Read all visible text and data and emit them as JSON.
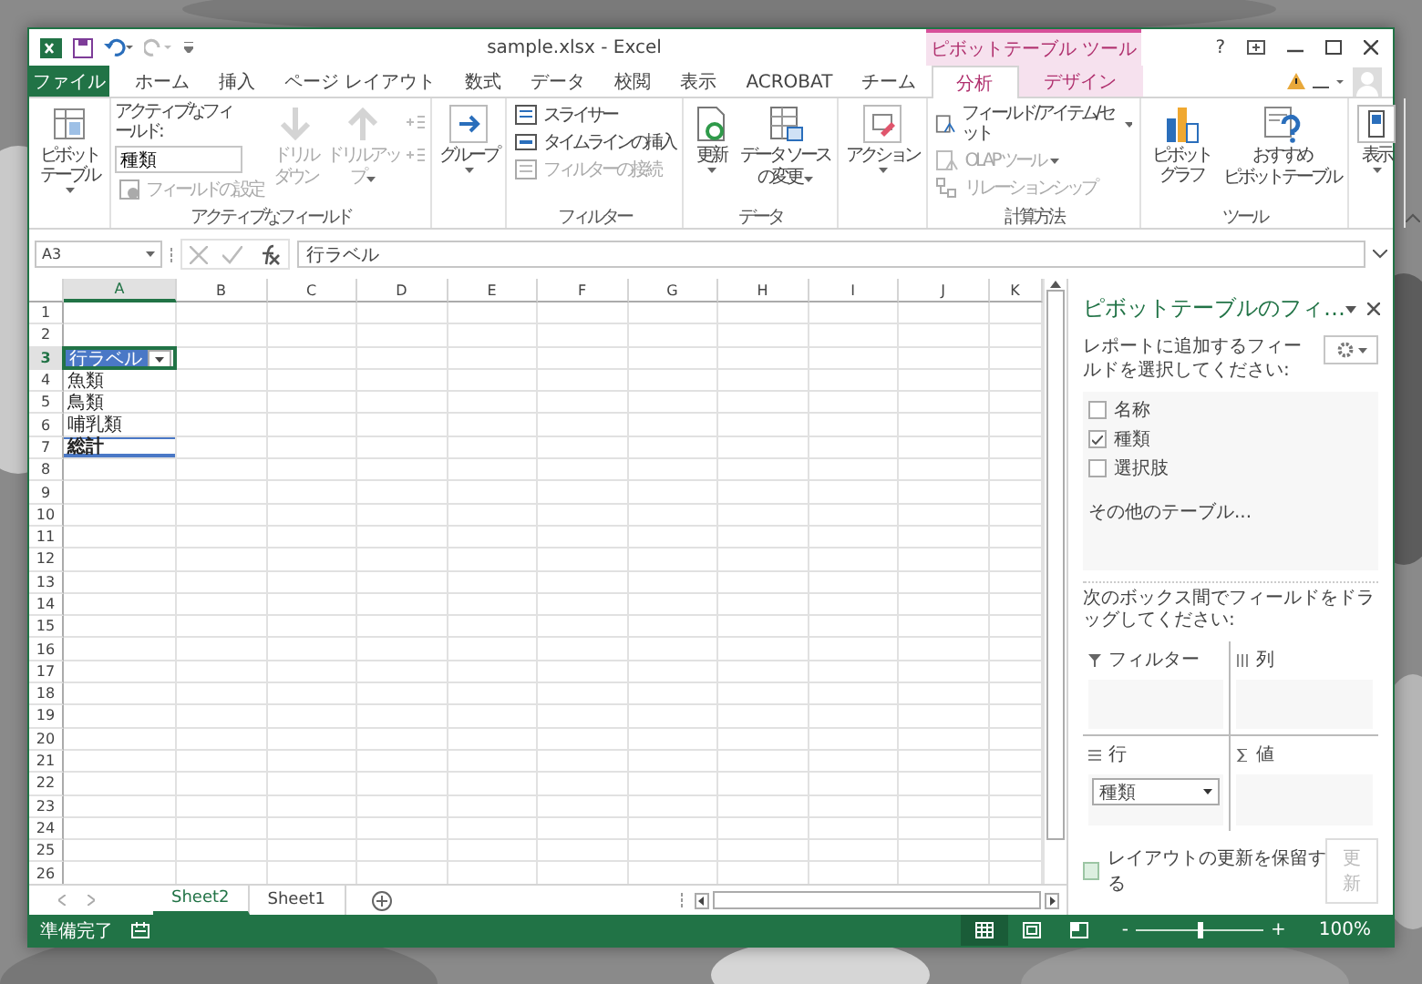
{
  "window": {
    "title": "sample.xlsx - Excel",
    "context_group": "ピボットテーブル ツール",
    "help": "?"
  },
  "tabs": [
    {
      "label": "ファイル",
      "kind": "file",
      "selected": false
    },
    {
      "label": "ホーム",
      "kind": "normal",
      "selected": false
    },
    {
      "label": "挿入",
      "kind": "normal",
      "selected": false
    },
    {
      "label": "ページ レイアウト",
      "kind": "normal",
      "selected": false
    },
    {
      "label": "数式",
      "kind": "normal",
      "selected": false
    },
    {
      "label": "データ",
      "kind": "normal",
      "selected": false
    },
    {
      "label": "校閲",
      "kind": "normal",
      "selected": false
    },
    {
      "label": "表示",
      "kind": "normal",
      "selected": false
    },
    {
      "label": "ACROBAT",
      "kind": "normal",
      "selected": false
    },
    {
      "label": "チーム",
      "kind": "normal",
      "selected": false
    },
    {
      "label": "分析",
      "kind": "context",
      "selected": true
    },
    {
      "label": "デザイン",
      "kind": "context",
      "selected": false
    }
  ],
  "ribbon": {
    "groups": [
      {
        "items": [
          {
            "kind": "large",
            "lines": [
              "ピボットテーブル"
            ],
            "dropdown": true,
            "disabled": false
          }
        ]
      },
      {
        "label": "アクティブなフィールド",
        "items": [
          {
            "kind": "field",
            "caption": "アクティブなフィールド:",
            "value": "種類",
            "button": {
              "label": "フィールドの設定",
              "disabled": true
            }
          },
          {
            "kind": "large",
            "lines": [
              "ドリル",
              "ダウン"
            ],
            "dropdown": false,
            "disabled": true
          },
          {
            "kind": "large",
            "lines": [
              "ドリルアッ",
              "プ"
            ],
            "dropdown": true,
            "disabled": true
          },
          {
            "kind": "mini",
            "disabled": true
          },
          {
            "kind": "mini",
            "disabled": true
          }
        ]
      },
      {
        "items": [
          {
            "kind": "large",
            "lines": [
              "グループ"
            ],
            "dropdown": true,
            "disabled": false
          }
        ]
      },
      {
        "label": "フィルター",
        "items": [
          {
            "kind": "small",
            "lines": [
              "スライサー"
            ],
            "dropdown": false,
            "disabled": false
          },
          {
            "kind": "small",
            "lines": [
              "タイムラインの挿入"
            ],
            "dropdown": false,
            "disabled": false
          },
          {
            "kind": "small",
            "lines": [
              "フィルターの接続"
            ],
            "dropdown": false,
            "disabled": true
          }
        ]
      },
      {
        "label": "データ",
        "items": [
          {
            "kind": "large",
            "lines": [
              "更新"
            ],
            "dropdown": true,
            "disabled": false
          },
          {
            "kind": "large",
            "lines": [
              "データ ソース",
              "の変更"
            ],
            "dropdown": true,
            "disabled": false
          }
        ]
      },
      {
        "items": [
          {
            "kind": "large",
            "lines": [
              "アクション"
            ],
            "dropdown": true,
            "disabled": false
          }
        ]
      },
      {
        "label": "計算方法",
        "items": [
          {
            "kind": "small",
            "lines": [
              "フィールド/アイテム/セット"
            ],
            "dropdown": true,
            "disabled": false
          },
          {
            "kind": "small",
            "lines": [
              "OLAP ツール"
            ],
            "dropdown": true,
            "disabled": true
          },
          {
            "kind": "small",
            "lines": [
              "リレーションシップ"
            ],
            "dropdown": false,
            "disabled": true
          }
        ]
      },
      {
        "label": "ツール",
        "items": [
          {
            "kind": "large",
            "lines": [
              "ピボットグラフ"
            ],
            "dropdown": false,
            "disabled": false
          },
          {
            "kind": "large",
            "lines": [
              "おすすめ",
              "ピボットテーブル"
            ],
            "dropdown": false,
            "disabled": false
          }
        ]
      },
      {
        "items": [
          {
            "kind": "large",
            "lines": [
              "表示"
            ],
            "dropdown": true,
            "disabled": false
          }
        ]
      }
    ]
  },
  "formula_bar": {
    "name_box": "A3",
    "formula": "行ラベル"
  },
  "sheet": {
    "columns": [
      {
        "label": "A",
        "selected": true
      },
      {
        "label": "B",
        "selected": false
      },
      {
        "label": "C",
        "selected": false
      },
      {
        "label": "D",
        "selected": false
      },
      {
        "label": "E",
        "selected": false
      },
      {
        "label": "F",
        "selected": false
      },
      {
        "label": "G",
        "selected": false
      },
      {
        "label": "H",
        "selected": false
      },
      {
        "label": "I",
        "selected": false
      },
      {
        "label": "J",
        "selected": false
      },
      {
        "label": "K",
        "selected": false
      }
    ],
    "rows": [
      {
        "label": "1",
        "selected": false
      },
      {
        "label": "2",
        "selected": false
      },
      {
        "label": "3",
        "selected": true,
        "kind": "header",
        "value": "行ラベル"
      },
      {
        "label": "4",
        "selected": false,
        "kind": "item",
        "value": "魚類"
      },
      {
        "label": "5",
        "selected": false,
        "kind": "item",
        "value": "鳥類"
      },
      {
        "label": "6",
        "selected": false,
        "kind": "item",
        "value": "哺乳類"
      },
      {
        "label": "7",
        "selected": false,
        "kind": "total",
        "value": "総計"
      },
      {
        "label": "8",
        "selected": false
      },
      {
        "label": "9",
        "selected": false
      },
      {
        "label": "10",
        "selected": false
      },
      {
        "label": "11",
        "selected": false
      },
      {
        "label": "12",
        "selected": false
      },
      {
        "label": "13",
        "selected": false
      },
      {
        "label": "14",
        "selected": false
      },
      {
        "label": "15",
        "selected": false
      },
      {
        "label": "16",
        "selected": false
      },
      {
        "label": "17",
        "selected": false
      },
      {
        "label": "18",
        "selected": false
      },
      {
        "label": "19",
        "selected": false
      },
      {
        "label": "20",
        "selected": false
      },
      {
        "label": "21",
        "selected": false
      },
      {
        "label": "22",
        "selected": false
      },
      {
        "label": "23",
        "selected": false
      },
      {
        "label": "24",
        "selected": false
      },
      {
        "label": "25",
        "selected": false
      },
      {
        "label": "26",
        "selected": false
      }
    ]
  },
  "sheet_tabs": [
    {
      "label": "Sheet2",
      "selected": true
    },
    {
      "label": "Sheet1",
      "selected": false
    }
  ],
  "pivot_pane": {
    "title": "ピボットテーブルのフィ…",
    "prompt": "レポートに追加するフィールドを選択してください:",
    "fields": [
      {
        "label": "名称",
        "checked": false
      },
      {
        "label": "種類",
        "checked": true
      },
      {
        "label": "選択肢",
        "checked": false
      }
    ],
    "more_tables": "その他のテーブル...",
    "drag_prompt": "次のボックス間でフィールドをドラッグしてください:",
    "areas": [
      {
        "label": "フィルター",
        "kind": "filter"
      },
      {
        "label": "列",
        "kind": "columns"
      },
      {
        "label": "行",
        "kind": "rows",
        "items": [
          "種類"
        ]
      },
      {
        "label": "値",
        "kind": "values"
      }
    ],
    "defer": {
      "label": "レイアウトの更新を保留する",
      "checked": false
    },
    "update_button": {
      "label": "更新",
      "disabled": true
    }
  },
  "status_bar": {
    "status": "準備完了",
    "views": [
      {
        "kind": "normal",
        "selected": true
      },
      {
        "kind": "page-layout",
        "selected": false
      },
      {
        "kind": "page-break",
        "selected": false
      }
    ],
    "zoom_out": "-",
    "zoom_in": "+",
    "zoom": {
      "level": 0.5
    },
    "zoom_label": "100%"
  }
}
